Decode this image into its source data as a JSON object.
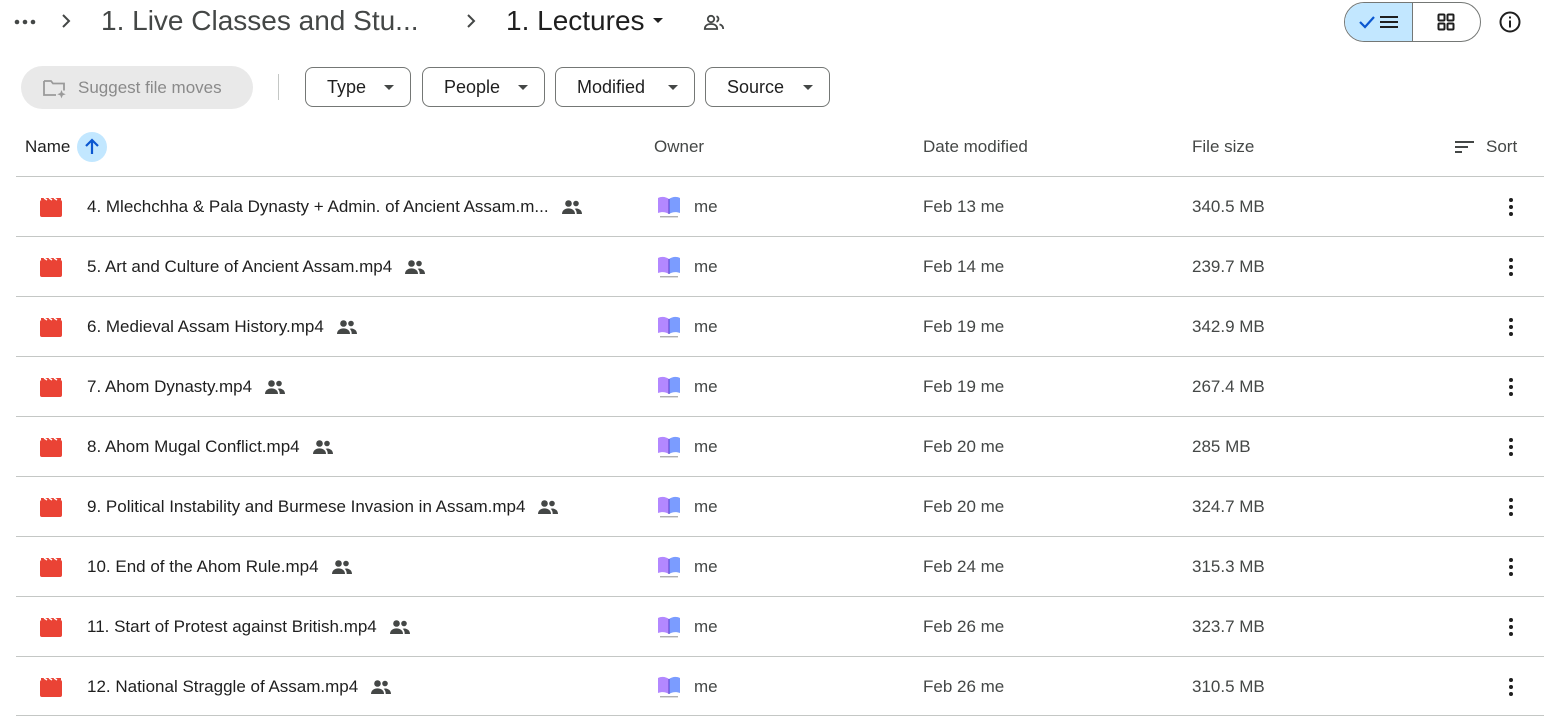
{
  "header": {
    "breadcrumbs": [
      {
        "label": "1. Live Classes and Stu..."
      },
      {
        "label": "1. Lectures"
      }
    ]
  },
  "toolbar": {
    "suggest_label": "Suggest file moves",
    "filters": [
      {
        "label": "Type"
      },
      {
        "label": "People"
      },
      {
        "label": "Modified"
      },
      {
        "label": "Source"
      }
    ]
  },
  "columns": {
    "name": "Name",
    "owner": "Owner",
    "date_modified": "Date modified",
    "file_size": "File size",
    "sort": "Sort"
  },
  "files": [
    {
      "name": "4. Mlechchha & Pala Dynasty + Admin. of Ancient Assam.m...",
      "owner": "me",
      "date": "Feb 13 me",
      "size": "340.5 MB"
    },
    {
      "name": "5. Art and Culture of Ancient Assam.mp4",
      "owner": "me",
      "date": "Feb 14 me",
      "size": "239.7 MB"
    },
    {
      "name": "6. Medieval Assam History.mp4",
      "owner": "me",
      "date": "Feb 19 me",
      "size": "342.9 MB"
    },
    {
      "name": "7. Ahom Dynasty.mp4",
      "owner": "me",
      "date": "Feb 19 me",
      "size": "267.4 MB"
    },
    {
      "name": "8. Ahom Mugal Conflict.mp4",
      "owner": "me",
      "date": "Feb 20 me",
      "size": "285 MB"
    },
    {
      "name": "9. Political Instability and Burmese Invasion in Assam.mp4",
      "owner": "me",
      "date": "Feb 20 me",
      "size": "324.7 MB"
    },
    {
      "name": "10. End of the Ahom Rule.mp4",
      "owner": "me",
      "date": "Feb 24 me",
      "size": "315.3 MB"
    },
    {
      "name": "11. Start of Protest against British.mp4",
      "owner": "me",
      "date": "Feb 26 me",
      "size": "323.7 MB"
    },
    {
      "name": "12. National Straggle of Assam.mp4",
      "owner": "me",
      "date": "Feb 26 me",
      "size": "310.5 MB"
    }
  ],
  "icons": {
    "file": "video-file-icon",
    "shared": "shared-people-icon",
    "owner": "book-avatar-icon",
    "row_menu": "more-vert-icon"
  },
  "colors": {
    "video_icon": "#ea4335",
    "accent": "#c2e7ff",
    "accent_icon": "#0b57d0",
    "divider": "#c4c7c5"
  }
}
